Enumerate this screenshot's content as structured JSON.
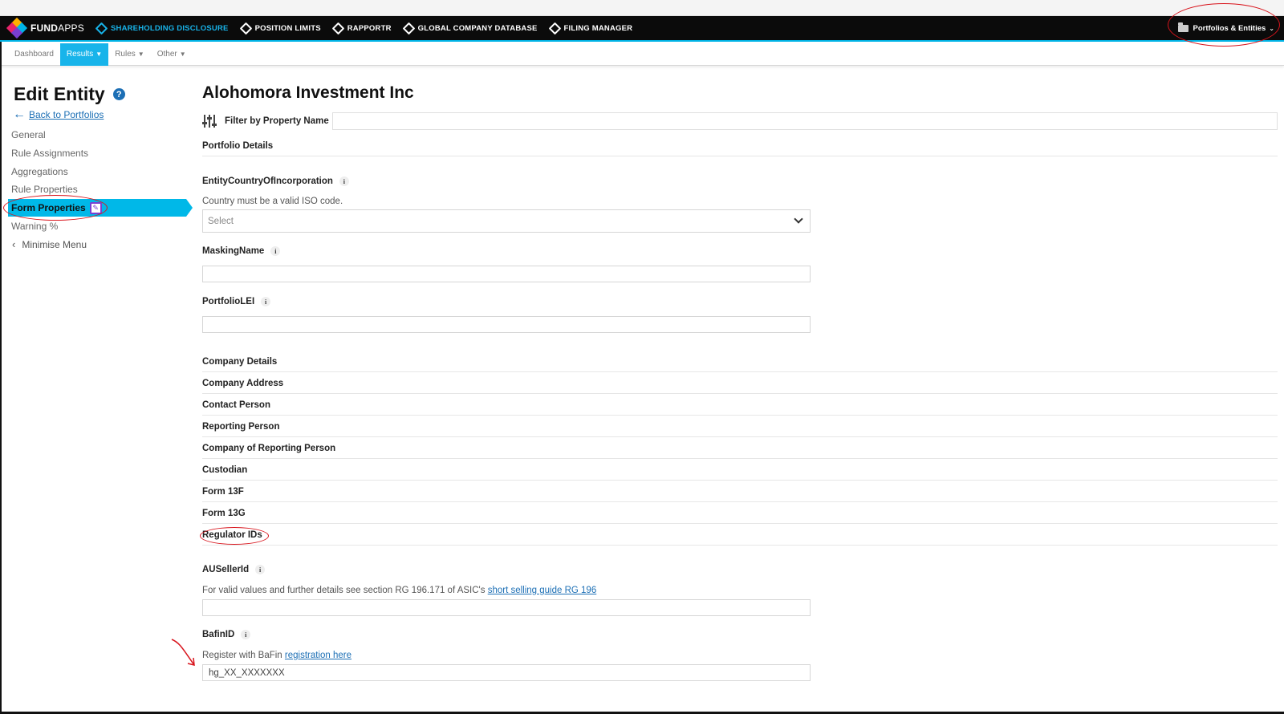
{
  "topnav": {
    "brand_left": "FUND",
    "brand_right": "APPS",
    "items": [
      {
        "label": "SHAREHOLDING DISCLOSURE",
        "active": true
      },
      {
        "label": "POSITION LIMITS",
        "active": false
      },
      {
        "label": "RAPPORTR",
        "active": false
      },
      {
        "label": "GLOBAL COMPANY DATABASE",
        "active": false
      },
      {
        "label": "FILING MANAGER",
        "active": false
      }
    ],
    "right_menu": "Portfolios & Entities"
  },
  "subnav": {
    "items": [
      {
        "label": "Dashboard",
        "dropdown": false,
        "active": false
      },
      {
        "label": "Results",
        "dropdown": true,
        "active": true
      },
      {
        "label": "Rules",
        "dropdown": true,
        "active": false
      },
      {
        "label": "Other",
        "dropdown": true,
        "active": false
      }
    ]
  },
  "sidebar": {
    "title": "Edit Entity",
    "help_icon": "?",
    "back_link": "Back to Portfolios",
    "items": [
      "General",
      "Rule Assignments",
      "Aggregations",
      "Rule Properties"
    ],
    "active_item": "Form Properties",
    "after_items": [
      "Warning %"
    ],
    "minimise": "Minimise Menu"
  },
  "main": {
    "entity_name": "Alohomora Investment Inc",
    "filter_label": "Filter by Property Name",
    "filter_value": "",
    "portfolio_details": "Portfolio Details",
    "country_label": "EntityCountryOfIncorporation",
    "country_help": "Country must be a valid ISO code.",
    "country_select": "Select",
    "masking_label": "MaskingName",
    "masking_value": "",
    "lei_label": "PortfolioLEI",
    "lei_value": "",
    "sections": [
      "Company Details",
      "Company Address",
      "Contact Person",
      "Reporting Person",
      "Company of Reporting Person",
      "Custodian",
      "Form 13F",
      "Form 13G",
      "Regulator IDs"
    ],
    "auseller_label": "AUSellerId",
    "auseller_help": "For valid values and further details see section RG 196.171 of ASIC's",
    "auseller_link": "short selling guide RG 196",
    "auseller_value": "",
    "bafin_label": "BafinID",
    "bafin_help": "Register with BaFin",
    "bafin_link": "registration here",
    "bafin_value": "hg_XX_XXXXXXX",
    "info_glyph": "i"
  },
  "colors": {
    "accent": "#18b4ea",
    "nav_bg": "#0b0b0b",
    "link": "#1c6fb5",
    "annotation": "#d8141c"
  }
}
